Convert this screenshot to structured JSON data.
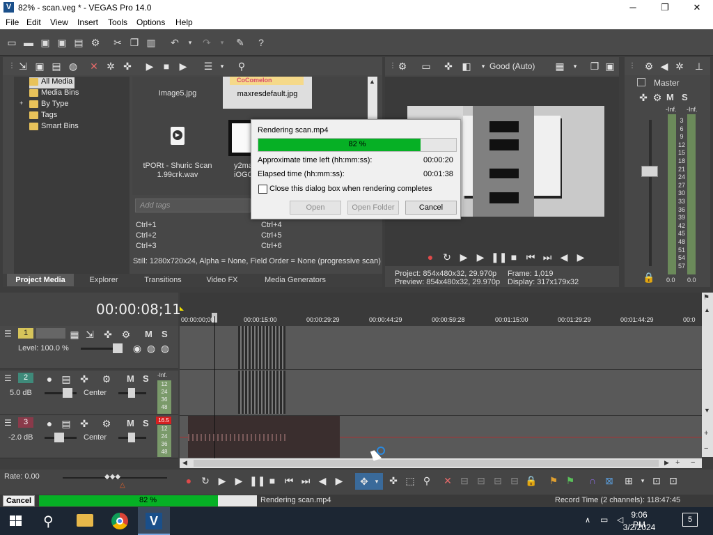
{
  "window": {
    "title": "82% - scan.veg * - VEGAS Pro 14.0",
    "minimize": "─",
    "maximize": "❐",
    "close": "✕"
  },
  "menu": [
    "File",
    "Edit",
    "View",
    "Insert",
    "Tools",
    "Options",
    "Help"
  ],
  "project_media": {
    "tree": [
      "All Media",
      "Media Bins",
      "By Type",
      "Tags",
      "Smart Bins"
    ],
    "expand_toggle": "+",
    "files": {
      "image5": "Image5.jpg",
      "maxres": "maxresdefault.jpg",
      "cocomelon_logo": "CoComelon",
      "wav_name": "tPORt - Shuric Scan",
      "wav_sub": "1.99crk.wav",
      "y2_name": "y2ma",
      "y2_sub": "iOGO"
    },
    "tags_placeholder": "Add tags",
    "shortcuts_left": [
      "Ctrl+1",
      "Ctrl+2",
      "Ctrl+3"
    ],
    "shortcuts_right": [
      "Ctrl+4",
      "Ctrl+5",
      "Ctrl+6"
    ],
    "info": "Still: 1280x720x24, Alpha = None, Field Order = None (progressive scan)",
    "tabs": [
      "Project Media",
      "Explorer",
      "Transitions",
      "Video FX",
      "Media Generators"
    ]
  },
  "preview": {
    "quality": "Good (Auto)",
    "project_label": "Project:",
    "project_value": "854x480x32, 29.970p",
    "preview_label": "Preview:",
    "preview_value": "854x480x32, 29.970p",
    "frame_label": "Frame:",
    "frame_value": "1,019",
    "display_label": "Display:",
    "display_value": "317x179x32"
  },
  "master": {
    "label": "Master",
    "m": "M",
    "s": "S",
    "inf_left": "-Inf.",
    "inf_right": "-Inf.",
    "scale": [
      "3",
      "6",
      "9",
      "12",
      "15",
      "18",
      "21",
      "24",
      "27",
      "30",
      "33",
      "36",
      "39",
      "42",
      "45",
      "48",
      "51",
      "54",
      "57"
    ],
    "bottom_left": "0.0",
    "bottom_right": "0.0"
  },
  "dialog": {
    "title": "Rendering scan.mp4",
    "progress_text": "82 %",
    "progress": 0.82,
    "time_left_label": "Approximate time left (hh:mm:ss):",
    "time_left": "00:00:20",
    "elapsed_label": "Elapsed time (hh:mm:ss):",
    "elapsed": "00:01:38",
    "checkbox_label": "Close this dialog box when rendering completes",
    "open": "Open",
    "open_folder": "Open Folder",
    "cancel": "Cancel"
  },
  "timeline": {
    "timecode": "00:00:08;11",
    "ruler": [
      "00:00:00;00",
      "00:00:15:00",
      "00:00:29:29",
      "00:00:44:29",
      "00:00:59:28",
      "00:01:15:00",
      "00:01:29:29",
      "00:01:44:29",
      "00:0"
    ],
    "tracks": [
      {
        "num": "1",
        "level": "Level: 100.0 %",
        "m": "M",
        "s": "S"
      },
      {
        "num": "2",
        "db": "5.0 dB",
        "pan": "Center",
        "inf": "-Inf.",
        "m": "M",
        "s": "S",
        "meter": [
          "12",
          "24",
          "36",
          "48"
        ]
      },
      {
        "num": "3",
        "db": "-2.0 dB",
        "pan": "Center",
        "peak": "16.5",
        "m": "M",
        "s": "S",
        "meter": [
          "12",
          "24",
          "36",
          "48"
        ]
      }
    ]
  },
  "transport": {
    "rate": "Rate: 0.00"
  },
  "statusbar": {
    "cancel": "Cancel",
    "progress_text": "82 %",
    "progress": 0.82,
    "message": "Rendering scan.mp4",
    "record_time": "Record Time (2 channels): 118:47:45"
  },
  "taskbar": {
    "time": "9:06 PM",
    "date": "3/2/2024",
    "notifications": "5"
  }
}
